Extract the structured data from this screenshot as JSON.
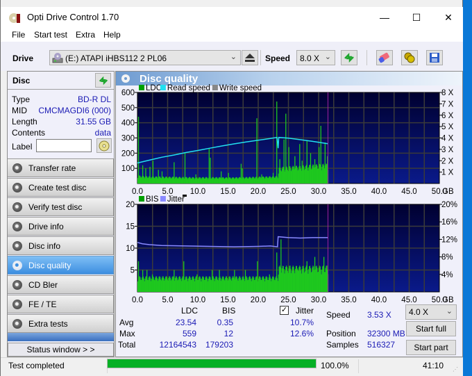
{
  "window": {
    "title": "Opti Drive Control 1.70",
    "controls": {
      "minimize": "—",
      "maximize": "☐",
      "close": "✕"
    }
  },
  "menu": [
    "File",
    "Start test",
    "Extra",
    "Help"
  ],
  "toolbar": {
    "drive_label": "Drive",
    "drive_value": "(E:)   ATAPI iHBS112   2 PL06",
    "speed_label": "Speed",
    "speed_value": "8.0 X",
    "icons": [
      "drive-icon",
      "eject-icon",
      "refresh-icon",
      "erase-icon",
      "copy-icon",
      "save-icon"
    ]
  },
  "disc": {
    "header": "Disc",
    "props": [
      {
        "key": "Type",
        "value": "BD-R DL"
      },
      {
        "key": "MID",
        "value": "CMCMAGDI6 (000)"
      },
      {
        "key": "Length",
        "value": "31.55 GB"
      },
      {
        "key": "Contents",
        "value": "data"
      }
    ],
    "label_key": "Label",
    "label_value": ""
  },
  "nav": [
    {
      "label": "Transfer rate",
      "active": false
    },
    {
      "label": "Create test disc",
      "active": false
    },
    {
      "label": "Verify test disc",
      "active": false
    },
    {
      "label": "Drive info",
      "active": false
    },
    {
      "label": "Disc info",
      "active": false
    },
    {
      "label": "Disc quality",
      "active": true
    },
    {
      "label": "CD Bler",
      "active": false
    },
    {
      "label": "FE / TE",
      "active": false
    },
    {
      "label": "Extra tests",
      "active": false
    }
  ],
  "status_window_button": "Status window > >",
  "panel": {
    "title": "Disc quality"
  },
  "chart_data": [
    {
      "type": "bar",
      "title": "LDC / Read speed",
      "legend": [
        {
          "name": "LDC",
          "color": "#00a000"
        },
        {
          "name": "Read speed",
          "color": "#22e0f0"
        },
        {
          "name": "Write speed",
          "color": "#888888"
        }
      ],
      "legend_position": "top-left",
      "xlabel": "GB",
      "x_ticks": [
        "0.0",
        "5.0",
        "10.0",
        "15.0",
        "20.0",
        "25.0",
        "30.0",
        "35.0",
        "40.0",
        "45.0",
        "50.0"
      ],
      "xlim": [
        0,
        50
      ],
      "y_left_ticks": [
        "100",
        "200",
        "300",
        "400",
        "500",
        "600"
      ],
      "ylim_left": [
        0,
        600
      ],
      "y_right_ticks": [
        "1 X",
        "2 X",
        "3 X",
        "4 X",
        "5 X",
        "6 X",
        "7 X",
        "8 X"
      ],
      "ylim_right": [
        0,
        8
      ],
      "grid": true,
      "data_end_gb": 31.55,
      "ldc_baseline": [
        [
          0,
          45
        ],
        [
          2,
          40
        ],
        [
          5,
          38
        ],
        [
          8,
          36
        ],
        [
          10,
          35
        ],
        [
          12,
          36
        ],
        [
          15,
          34
        ],
        [
          18,
          36
        ],
        [
          20,
          38
        ],
        [
          22,
          40
        ],
        [
          23.2,
          42
        ],
        [
          23.4,
          90
        ],
        [
          25,
          95
        ],
        [
          27,
          100
        ],
        [
          29,
          105
        ],
        [
          31.5,
          110
        ]
      ],
      "ldc_spikes": [
        [
          0.1,
          440
        ],
        [
          0.8,
          120
        ],
        [
          1.3,
          100
        ],
        [
          2.0,
          110
        ],
        [
          2.5,
          150
        ],
        [
          3.4,
          90
        ],
        [
          4.0,
          80
        ],
        [
          6.0,
          140
        ],
        [
          7.8,
          200
        ],
        [
          9.6,
          60
        ],
        [
          11.8,
          230
        ],
        [
          12.0,
          170
        ],
        [
          13.8,
          80
        ],
        [
          15.0,
          70
        ],
        [
          17.1,
          130
        ],
        [
          17.3,
          100
        ],
        [
          19.7,
          430
        ],
        [
          20.5,
          60
        ],
        [
          22.4,
          70
        ],
        [
          23.0,
          540
        ],
        [
          23.5,
          160
        ],
        [
          24.2,
          290
        ],
        [
          24.5,
          460
        ],
        [
          25.0,
          240
        ],
        [
          26.0,
          180
        ],
        [
          26.8,
          260
        ],
        [
          27.2,
          150
        ],
        [
          28.0,
          280
        ],
        [
          28.6,
          200
        ],
        [
          29.3,
          160
        ],
        [
          30.0,
          240
        ],
        [
          30.3,
          380
        ],
        [
          31.0,
          270
        ],
        [
          31.4,
          180
        ]
      ],
      "read_speed_x": [
        [
          0,
          1.8
        ],
        [
          2,
          2.05
        ],
        [
          4,
          2.3
        ],
        [
          6,
          2.5
        ],
        [
          8,
          2.72
        ],
        [
          10,
          2.9
        ],
        [
          12,
          3.1
        ],
        [
          14,
          3.3
        ],
        [
          16,
          3.48
        ],
        [
          18,
          3.65
        ],
        [
          20,
          3.8
        ],
        [
          22,
          3.95
        ],
        [
          23.1,
          4.05
        ],
        [
          23.3,
          3.1
        ],
        [
          23.4,
          4.05
        ],
        [
          25,
          3.98
        ],
        [
          27,
          3.85
        ],
        [
          29,
          3.7
        ],
        [
          31.5,
          3.5
        ]
      ]
    },
    {
      "type": "bar",
      "title": "BIS / Jitter",
      "legend": [
        {
          "name": "BIS",
          "color": "#00a000"
        },
        {
          "name": "Jitter",
          "color": "#8a8aff"
        }
      ],
      "legend_position": "top-left",
      "xlabel": "GB",
      "x_ticks": [
        "0.0",
        "5.0",
        "10.0",
        "15.0",
        "20.0",
        "25.0",
        "30.0",
        "35.0",
        "40.0",
        "45.0",
        "50.0"
      ],
      "xlim": [
        0,
        50
      ],
      "y_left_ticks": [
        "5",
        "10",
        "15",
        "20"
      ],
      "ylim_left": [
        0,
        20
      ],
      "y_right_ticks": [
        "4%",
        "8%",
        "12%",
        "16%",
        "20%"
      ],
      "ylim_right": [
        0,
        20
      ],
      "grid": true,
      "data_end_gb": 31.55,
      "bis_baseline": [
        [
          0,
          3
        ],
        [
          5,
          3
        ],
        [
          10,
          3
        ],
        [
          15,
          3
        ],
        [
          20,
          3
        ],
        [
          23.2,
          3
        ],
        [
          23.4,
          5
        ],
        [
          31.5,
          5
        ]
      ],
      "bis_spikes": [
        [
          0.1,
          7
        ],
        [
          0.8,
          5
        ],
        [
          1.5,
          5
        ],
        [
          2.4,
          4
        ],
        [
          6.0,
          5
        ],
        [
          7.6,
          7
        ],
        [
          9.8,
          4
        ],
        [
          12.3,
          5
        ],
        [
          13.5,
          5
        ],
        [
          16.0,
          5
        ],
        [
          17.8,
          5
        ],
        [
          19.8,
          7
        ],
        [
          21.8,
          4
        ],
        [
          23.0,
          9
        ],
        [
          23.7,
          12
        ],
        [
          25.2,
          6
        ],
        [
          26.5,
          5
        ],
        [
          28.0,
          7
        ],
        [
          29.3,
          8
        ],
        [
          30.8,
          8
        ],
        [
          31.3,
          6
        ]
      ],
      "jitter_pct": [
        [
          0,
          11.3
        ],
        [
          0.8,
          11.0
        ],
        [
          2,
          10.8
        ],
        [
          4,
          10.6
        ],
        [
          8,
          10.5
        ],
        [
          12,
          10.4
        ],
        [
          16,
          10.3
        ],
        [
          20,
          10.4
        ],
        [
          22,
          10.5
        ],
        [
          23.2,
          10.3
        ],
        [
          23.3,
          12.6
        ],
        [
          25,
          12.4
        ],
        [
          27,
          12.3
        ],
        [
          29,
          12.4
        ],
        [
          31.5,
          12.4
        ]
      ]
    }
  ],
  "stats": {
    "col_ldc": "LDC",
    "col_bis": "BIS",
    "jitter_label": "Jitter",
    "jitter_checked": true,
    "rows": [
      {
        "label": "Avg",
        "ldc": "23.54",
        "bis": "0.35",
        "jitter": "10.7%"
      },
      {
        "label": "Max",
        "ldc": "559",
        "bis": "12",
        "jitter": "12.6%"
      },
      {
        "label": "Total",
        "ldc": "12164543",
        "bis": "179203",
        "jitter": ""
      }
    ],
    "speed_label": "Speed",
    "speed_value": "3.53 X",
    "speed_select": "4.0 X",
    "position_label": "Position",
    "position_value": "32300 MB",
    "samples_label": "Samples",
    "samples_value": "516327",
    "start_full": "Start full",
    "start_part": "Start part"
  },
  "statusbar": {
    "text": "Test completed",
    "progress": 1.0,
    "progress_text": "100.0%",
    "time": "41:10"
  }
}
